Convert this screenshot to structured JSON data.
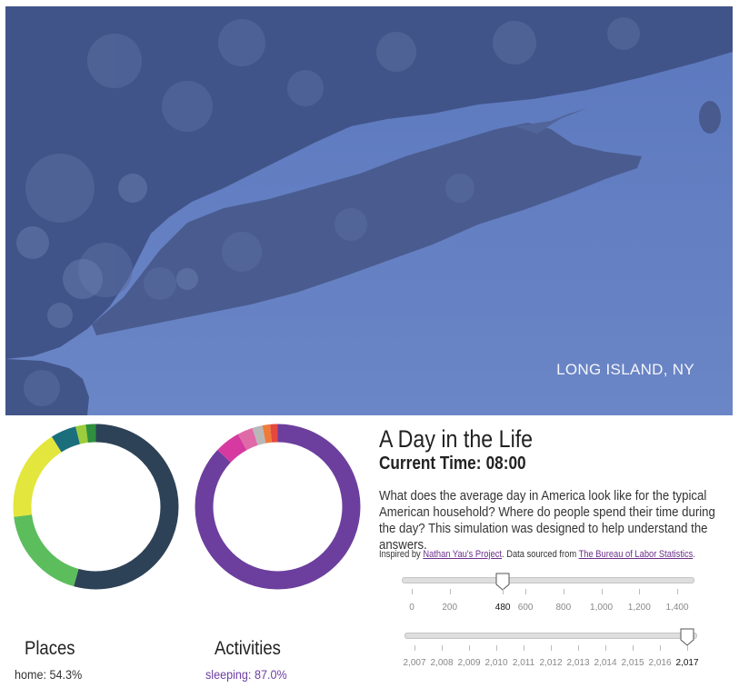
{
  "hero": {
    "caption": "LONG ISLAND, NY",
    "water_color": "#5f7bc0",
    "land_color": "#3f5288"
  },
  "header": {
    "title": "A Day in the Life",
    "current_time_label": "Current Time:",
    "current_time_value": "08:00"
  },
  "description": "What does the average day in America look like for the typical American household? Where do people spend their time during the day? This simulation was designed to help understand the answers.",
  "credits": {
    "prefix": "Inspired by ",
    "project_link": "Nathan Yau's Project",
    "middle": ". Data sourced from ",
    "bls_link": "The Bureau of Labor Statistics",
    "suffix": "."
  },
  "time_slider": {
    "value": 480,
    "min": 0,
    "max": 1440,
    "ticks": [
      "0",
      "200",
      "480",
      "600",
      "800",
      "1,000",
      "1,200",
      "1,400"
    ],
    "tick_values": [
      0,
      200,
      480,
      600,
      800,
      1000,
      1200,
      1400
    ]
  },
  "year_slider": {
    "value": 2017,
    "ticks": [
      "2,007",
      "2,008",
      "2,009",
      "2,010",
      "2,011",
      "2,012",
      "2,013",
      "2,014",
      "2,015",
      "2,016",
      "2,017"
    ],
    "tick_values": [
      2007,
      2008,
      2009,
      2010,
      2011,
      2012,
      2013,
      2014,
      2015,
      2016,
      2017
    ]
  },
  "places": {
    "title": "Places",
    "selected": "home: 54.3%",
    "segments": [
      {
        "percent": 54.3,
        "color": "#2e4257"
      },
      {
        "percent": 18.7,
        "color": "#5cbd5c"
      },
      {
        "percent": 18.0,
        "color": "#e3e63c"
      },
      {
        "percent": 5.0,
        "color": "#1b6f7d"
      },
      {
        "percent": 2.0,
        "color": "#9ccd3c"
      },
      {
        "percent": 2.0,
        "color": "#2f8f3f"
      }
    ]
  },
  "activities": {
    "title": "Activities",
    "selected": "sleeping: 87.0%",
    "segments": [
      {
        "percent": 87.0,
        "color": "#6c3f9e"
      },
      {
        "percent": 5.0,
        "color": "#d63aa0"
      },
      {
        "percent": 3.0,
        "color": "#e06aa8"
      },
      {
        "percent": 2.0,
        "color": "#b8b8b8"
      },
      {
        "percent": 1.5,
        "color": "#ee7b3a"
      },
      {
        "percent": 1.5,
        "color": "#e4483f"
      }
    ]
  }
}
